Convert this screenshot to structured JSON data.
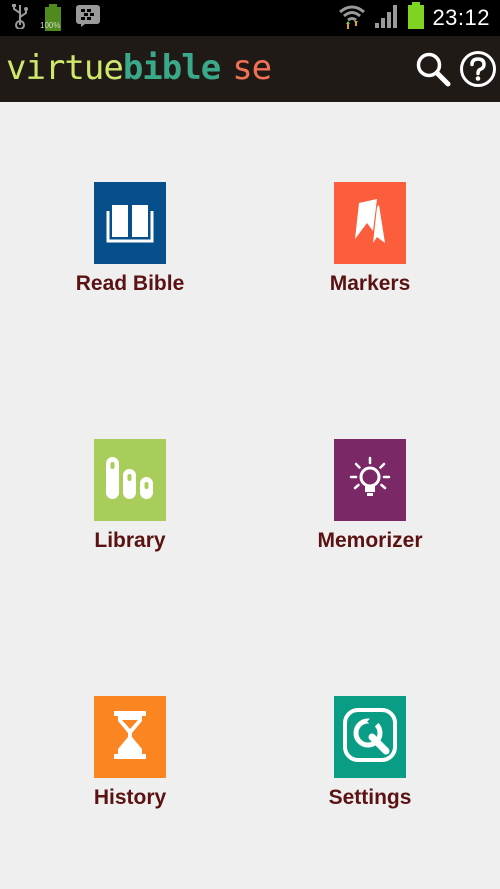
{
  "status_bar": {
    "time": "23:12",
    "battery_badge": "100%",
    "icons": [
      "usb-icon",
      "battery-full-icon",
      "bbm-icon",
      "wifi-icon",
      "signal-icon",
      "battery-icon"
    ]
  },
  "app_bar": {
    "logo_part1": "virtue",
    "logo_part2": "bible",
    "logo_part3": "se",
    "actions": [
      "search-icon",
      "help-icon"
    ]
  },
  "menu": {
    "items": [
      {
        "label": "Read Bible",
        "icon": "open-book-icon",
        "color": "#064f8a"
      },
      {
        "label": "Markers",
        "icon": "bookmark-ribbon-icon",
        "color": "#fb5d3d"
      },
      {
        "label": "Library",
        "icon": "books-icon",
        "color": "#a9cd5b"
      },
      {
        "label": "Memorizer",
        "icon": "lightbulb-icon",
        "color": "#7b2866"
      },
      {
        "label": "History",
        "icon": "hourglass-icon",
        "color": "#fb8521"
      },
      {
        "label": "Settings",
        "icon": "wrench-icon",
        "color": "#0a9d86"
      }
    ]
  },
  "colors": {
    "background": "#efefef",
    "status_bar": "#000000",
    "app_bar": "#201a17",
    "label_text": "#5a1212"
  }
}
